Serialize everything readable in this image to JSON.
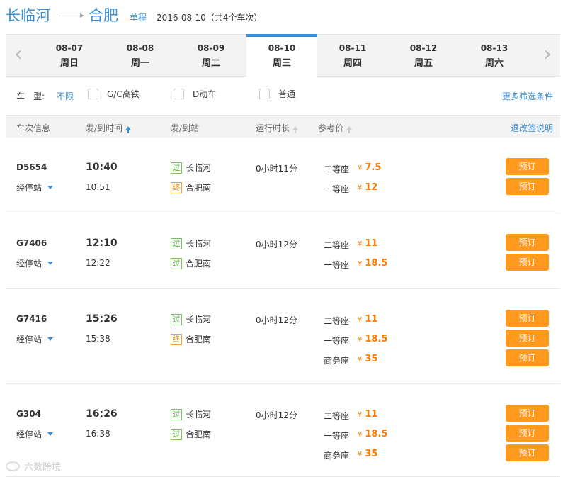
{
  "header": {
    "from_city": "长临河",
    "to_city": "合肥",
    "trip_type": "单程",
    "trip_info": "2016-08-10（共4个车次）"
  },
  "datebar": {
    "tabs": [
      {
        "date": "08-07",
        "weekday": "周日"
      },
      {
        "date": "08-08",
        "weekday": "周一"
      },
      {
        "date": "08-09",
        "weekday": "周二"
      },
      {
        "date": "08-10",
        "weekday": "周三"
      },
      {
        "date": "08-11",
        "weekday": "周四"
      },
      {
        "date": "08-12",
        "weekday": "周五"
      },
      {
        "date": "08-13",
        "weekday": "周六"
      }
    ],
    "active_index": 3,
    "prev_arrow": "‹",
    "next_arrow": "›"
  },
  "filter": {
    "label": "车　型:",
    "all_label": "不限",
    "options": [
      "G/C高铁",
      "D动车",
      "普通"
    ],
    "more_label": "更多筛选条件"
  },
  "table_header": {
    "train_info": "车次信息",
    "time": "发/到时间",
    "station": "发/到站",
    "duration": "运行时长",
    "price": "参考价",
    "refund_link": "退改签说明"
  },
  "labels": {
    "stops": "经停站",
    "pass_tag": "过",
    "end_tag": "终",
    "book": "预订",
    "currency": "¥"
  },
  "trains": [
    {
      "no": "D5654",
      "dep": "10:40",
      "arr": "10:51",
      "from": "长临河",
      "from_tag": "过",
      "to": "合肥南",
      "to_tag": "终",
      "duration": "0小时11分",
      "seats": [
        {
          "name": "二等座",
          "price": "7.5"
        },
        {
          "name": "一等座",
          "price": "12"
        }
      ]
    },
    {
      "no": "G7406",
      "dep": "12:10",
      "arr": "12:22",
      "from": "长临河",
      "from_tag": "过",
      "to": "合肥南",
      "to_tag": "过",
      "duration": "0小时12分",
      "seats": [
        {
          "name": "二等座",
          "price": "11"
        },
        {
          "name": "一等座",
          "price": "18.5"
        }
      ]
    },
    {
      "no": "G7416",
      "dep": "15:26",
      "arr": "15:38",
      "from": "长临河",
      "from_tag": "过",
      "to": "合肥南",
      "to_tag": "终",
      "duration": "0小时12分",
      "seats": [
        {
          "name": "二等座",
          "price": "11"
        },
        {
          "name": "一等座",
          "price": "18.5"
        },
        {
          "name": "商务座",
          "price": "35"
        }
      ]
    },
    {
      "no": "G304",
      "dep": "16:26",
      "arr": "16:38",
      "from": "长临河",
      "from_tag": "过",
      "to": "合肥南",
      "to_tag": "过",
      "duration": "0小时12分",
      "seats": [
        {
          "name": "二等座",
          "price": "11"
        },
        {
          "name": "一等座",
          "price": "18.5"
        },
        {
          "name": "商务座",
          "price": "35"
        }
      ]
    }
  ],
  "watermark": "六数跨境",
  "colors": {
    "accent": "#3a8fd6",
    "price": "#ff7a00",
    "book_button": "#ff9a1e"
  }
}
